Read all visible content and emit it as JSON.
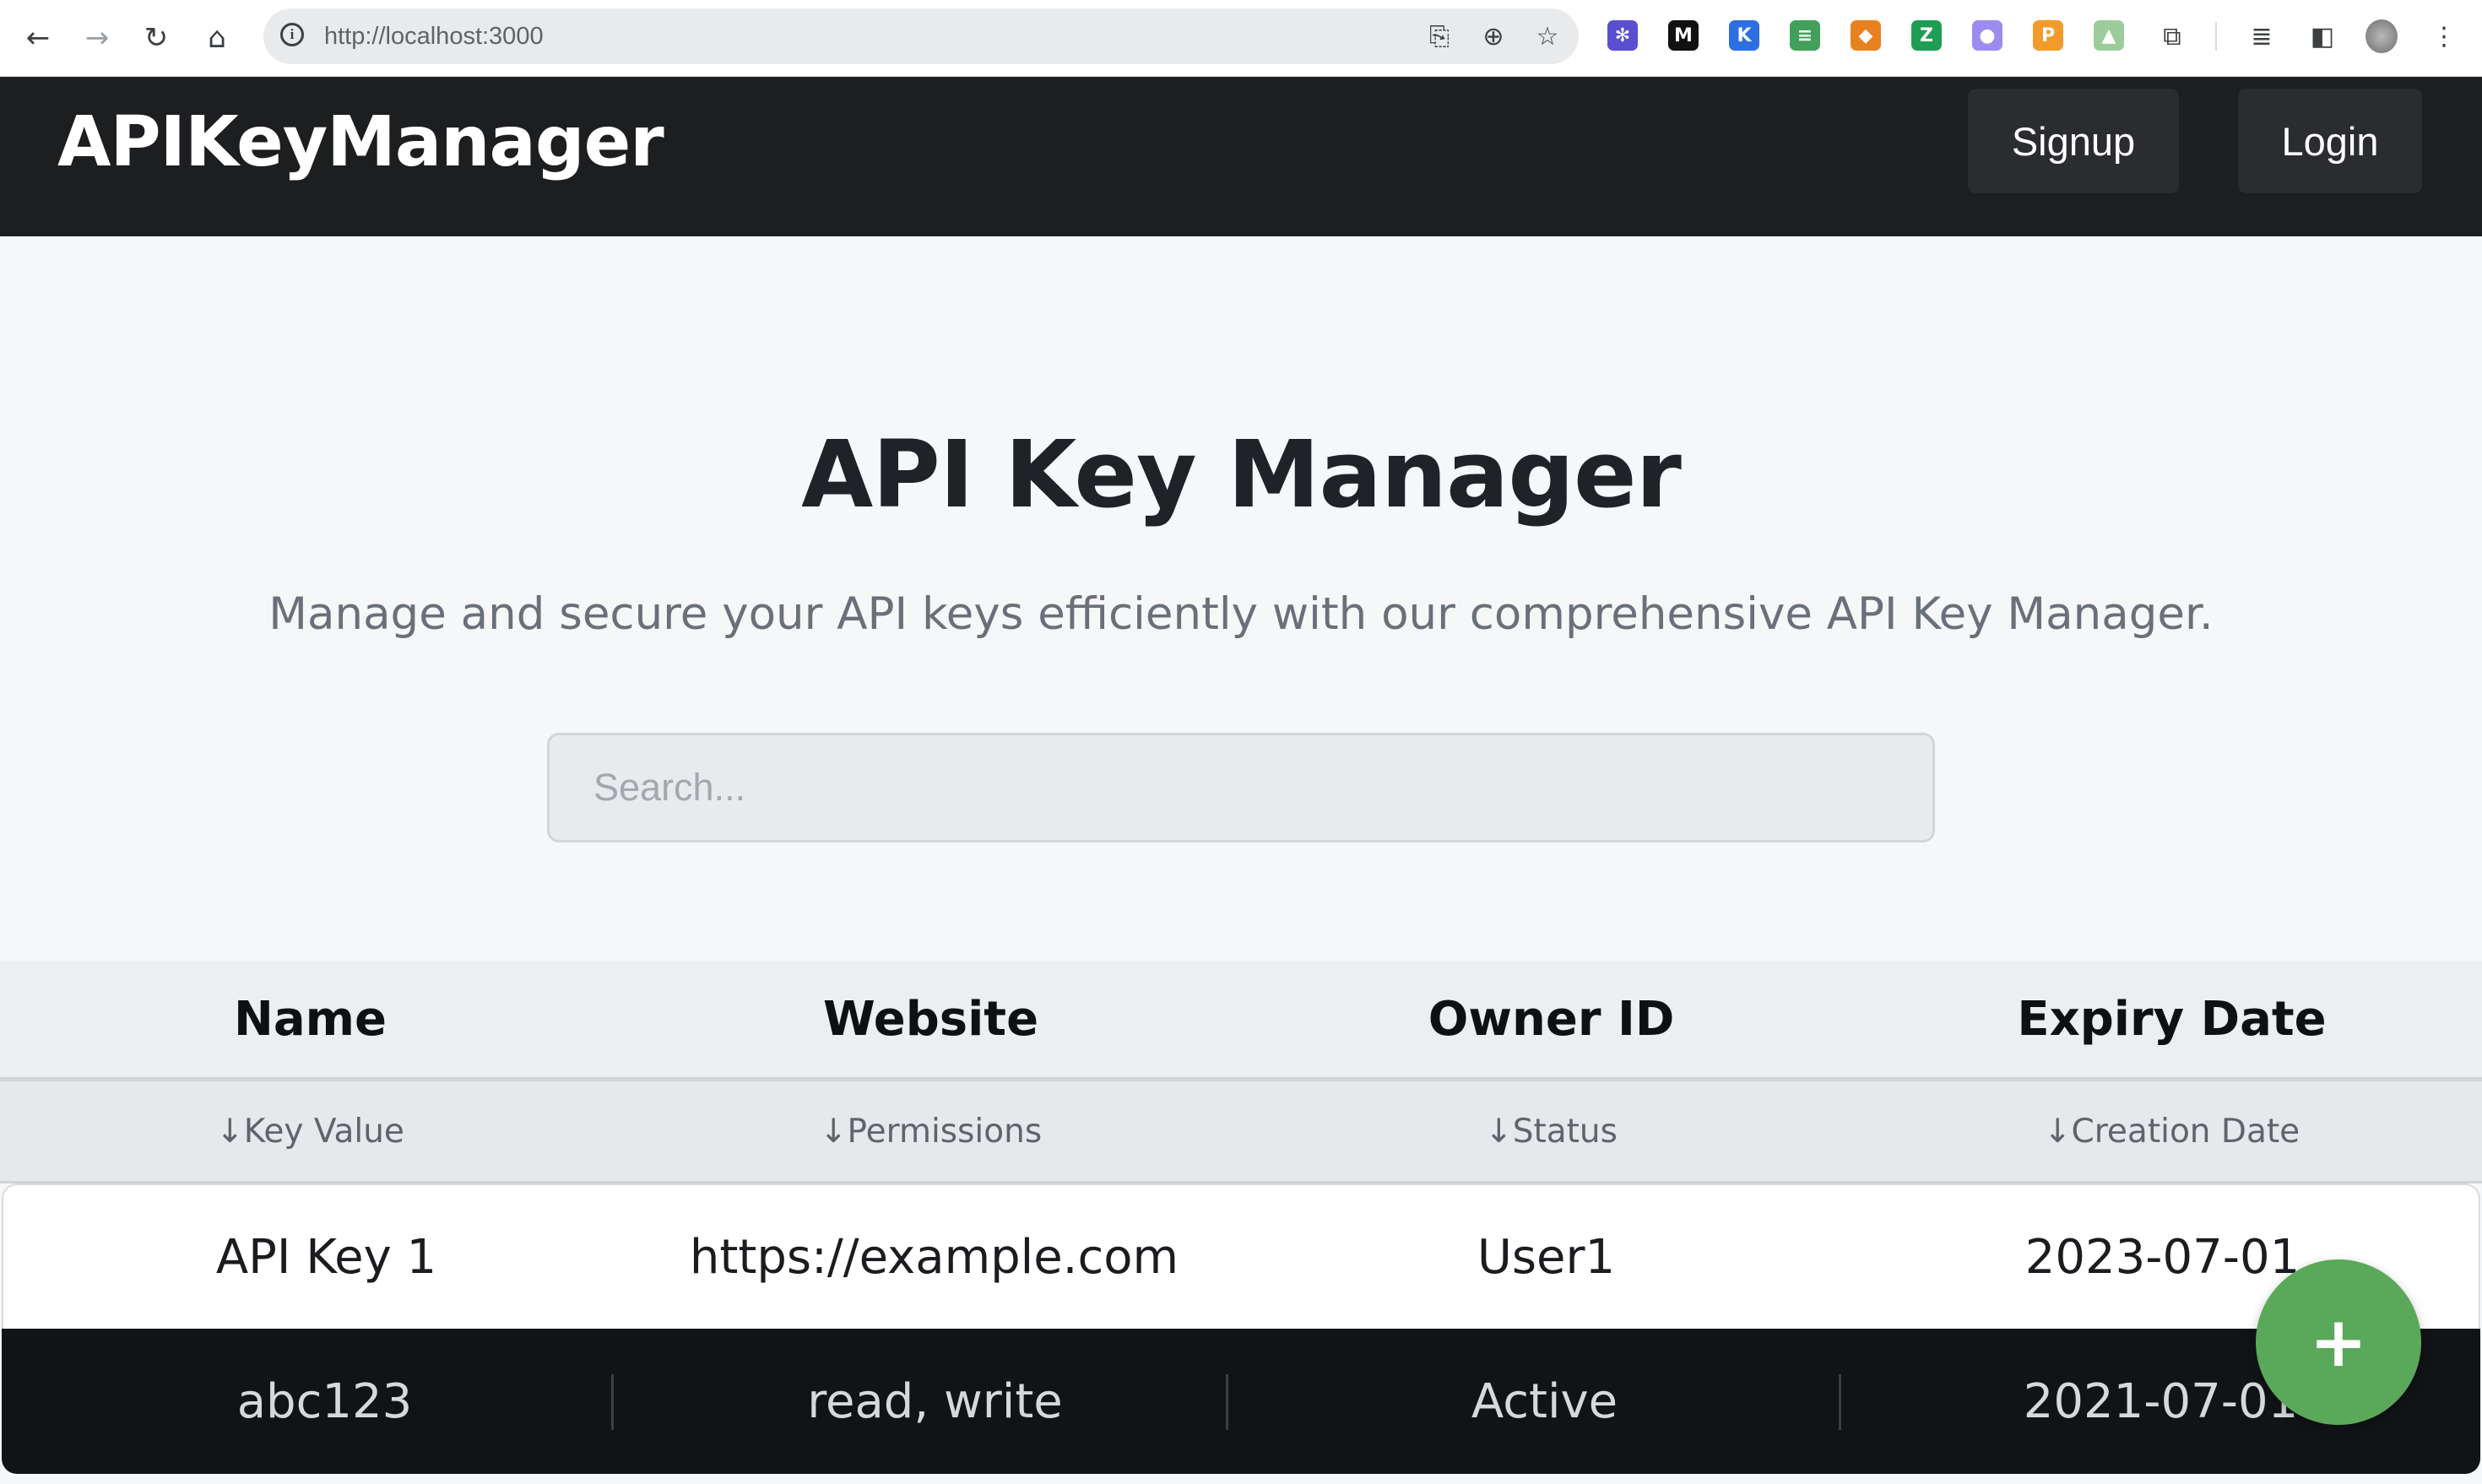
{
  "browser": {
    "url": "http://localhost:3000",
    "extensions": [
      {
        "icon": "star-burst-extension-icon",
        "glyph": "✻",
        "color": "#5a4fcf"
      },
      {
        "icon": "medium-extension-icon",
        "glyph": "M",
        "color": "#111111"
      },
      {
        "icon": "k-extension-icon",
        "glyph": "K",
        "color": "#2d6fe0"
      },
      {
        "icon": "stack-extension-icon",
        "glyph": "≡",
        "color": "#42a05a"
      },
      {
        "icon": "fox-extension-icon",
        "glyph": "◆",
        "color": "#e8821e"
      },
      {
        "icon": "z-extension-icon",
        "glyph": "Z",
        "color": "#1f9d55"
      },
      {
        "icon": "bird-extension-icon",
        "glyph": "●",
        "color": "#9b8cf0"
      },
      {
        "icon": "coin-extension-icon",
        "glyph": "P",
        "color": "#f29b2b"
      },
      {
        "icon": "dinosaur-extension-icon",
        "glyph": "▲",
        "color": "#9ccc9c"
      }
    ]
  },
  "navbar": {
    "brand": "APIKeyManager",
    "signup_label": "Signup",
    "login_label": "Login"
  },
  "hero": {
    "title": "API Key Manager",
    "subtitle": "Manage and secure your API keys efficiently with our comprehensive API Key Manager.",
    "search_placeholder": "Search..."
  },
  "table": {
    "headers": [
      "Name",
      "Website",
      "Owner ID",
      "Expiry Date"
    ],
    "subheaders": [
      "↓Key Value",
      "↓Permissions",
      "↓Status",
      "↓Creation Date"
    ],
    "rows": [
      {
        "name": "API Key 1",
        "website": "https://example.com",
        "owner_id": "User1",
        "expiry_date": "2023-07-01",
        "key_value": "abc123",
        "permissions": "read, write",
        "status": "Active",
        "creation_date": "2021-07-01"
      }
    ]
  },
  "fab": {
    "label": "+"
  },
  "colors": {
    "navbar_bg": "#1d1e20",
    "fab_green": "#5aa85a",
    "dark_row_bg": "#111316"
  }
}
